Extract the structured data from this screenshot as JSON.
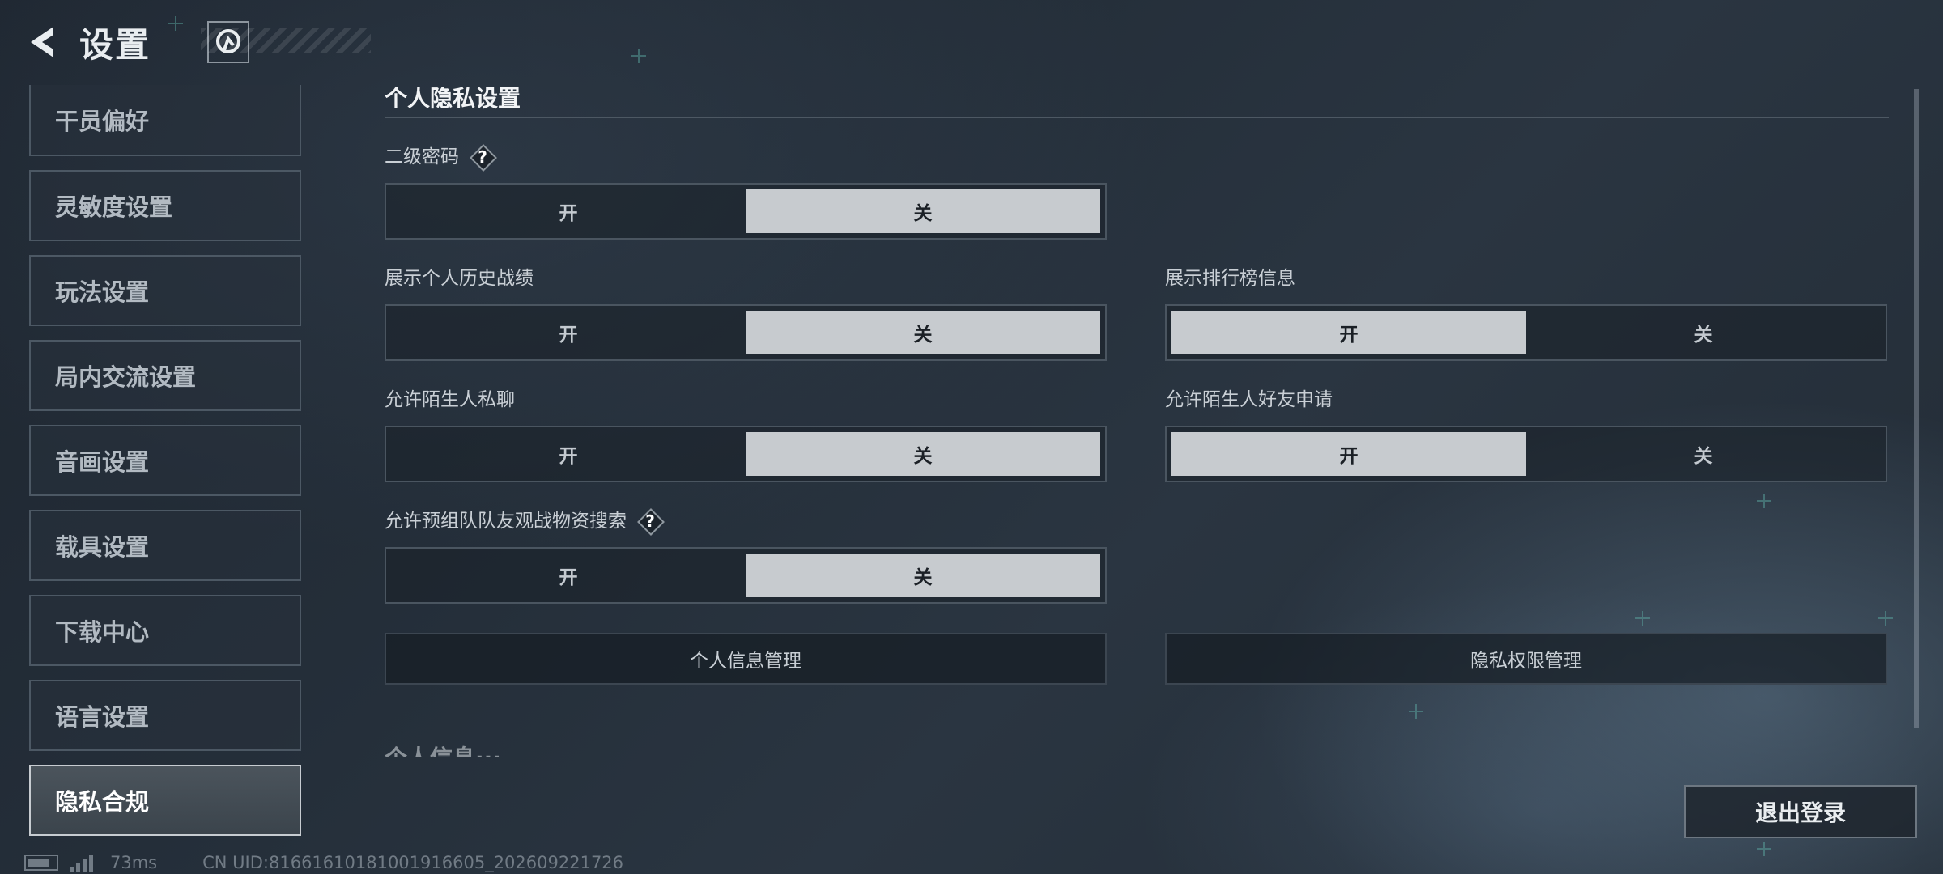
{
  "header": {
    "title": "设置",
    "back_icon": "back-arrow-icon",
    "logo_icon": "game-logo-icon"
  },
  "sidebar": {
    "items": [
      {
        "label": "干员偏好",
        "active": false
      },
      {
        "label": "灵敏度设置",
        "active": false
      },
      {
        "label": "玩法设置",
        "active": false
      },
      {
        "label": "局内交流设置",
        "active": false
      },
      {
        "label": "音画设置",
        "active": false
      },
      {
        "label": "载具设置",
        "active": false
      },
      {
        "label": "下载中心",
        "active": false
      },
      {
        "label": "语言设置",
        "active": false
      },
      {
        "label": "隐私合规",
        "active": true
      }
    ]
  },
  "main": {
    "section_title": "个人隐私设置",
    "on_label": "开",
    "off_label": "关",
    "settings": {
      "secondary_password": {
        "label": "二级密码",
        "help": "?",
        "value": "off"
      },
      "show_history": {
        "label": "展示个人历史战绩",
        "value": "off"
      },
      "show_leaderboard": {
        "label": "展示排行榜信息",
        "value": "on"
      },
      "stranger_chat": {
        "label": "允许陌生人私聊",
        "value": "off"
      },
      "stranger_friend_request": {
        "label": "允许陌生人好友申请",
        "value": "on"
      },
      "team_loot_search": {
        "label": "允许预组队队友观战物资搜索",
        "help": "?",
        "value": "off"
      }
    },
    "personal_info_btn": "个人信息管理",
    "privacy_permission_btn": "隐私权限管理",
    "next_section_partial": "个人信息···"
  },
  "logout_label": "退出登录",
  "footer": {
    "ping": "73ms",
    "uid": "CN UID:81661610181001916605_202609221726"
  },
  "colors": {
    "accent_on": "#c7cbcf",
    "background": "#232d37"
  }
}
